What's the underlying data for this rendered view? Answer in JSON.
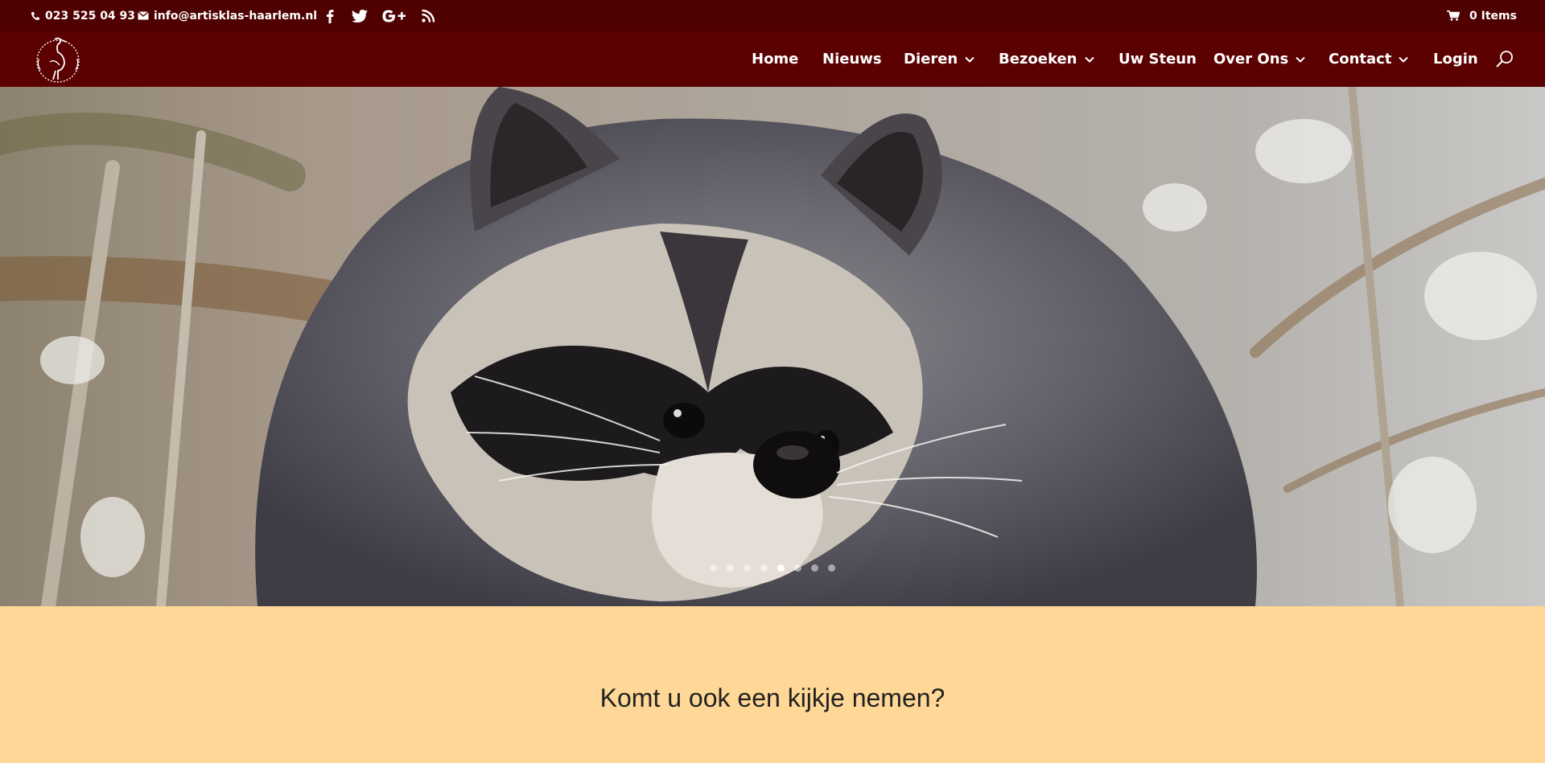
{
  "topbar": {
    "phone": "023 525 04 93",
    "email": "info@artisklas-haarlem.nl",
    "cart": "0 Items",
    "social_icons": [
      "facebook-icon",
      "twitter-icon",
      "google-plus-icon",
      "rss-icon"
    ]
  },
  "nav": {
    "items": [
      {
        "label": "Home",
        "has_dropdown": false
      },
      {
        "label": "Nieuws",
        "has_dropdown": false
      },
      {
        "label": "Dieren",
        "has_dropdown": true
      },
      {
        "label": "Bezoeken",
        "has_dropdown": true
      },
      {
        "label": "Uw Steun",
        "has_dropdown": false
      },
      {
        "label": "Over Ons",
        "has_dropdown": true
      },
      {
        "label": "Contact",
        "has_dropdown": true
      },
      {
        "label": "Login",
        "has_dropdown": false
      }
    ],
    "search_icon": "search-icon"
  },
  "hero": {
    "slide_count": 8,
    "active_slide": 5
  },
  "section": {
    "heading": "Komt u ook een kijkje nemen?"
  },
  "colors": {
    "topbar_bg": "#4f0000",
    "nav_bg": "#5c0101",
    "section_bg": "#ffd796",
    "text_light": "#ffffff",
    "heading": "#222222"
  }
}
